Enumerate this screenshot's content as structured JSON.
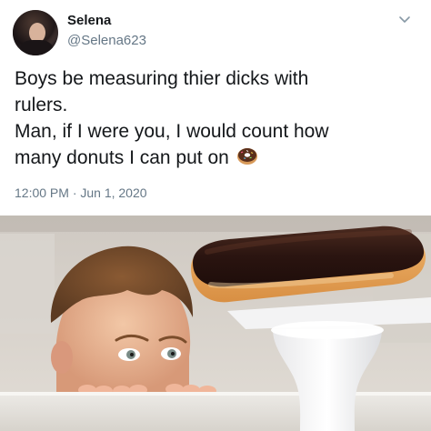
{
  "tweet": {
    "display_name": "Selena",
    "handle": "@Selena623",
    "text_lines": [
      "Boys be measuring thier dicks with",
      "rulers.",
      "Man, if I were you, I would count how",
      "many donuts I can put on"
    ],
    "timestamp": "12:00 PM · Jun 1, 2020",
    "icons": {
      "more": "chevron-down-icon",
      "emoji": "donut-emoji-icon"
    }
  },
  "colors": {
    "text_primary": "#14171a",
    "text_secondary": "#657786"
  }
}
